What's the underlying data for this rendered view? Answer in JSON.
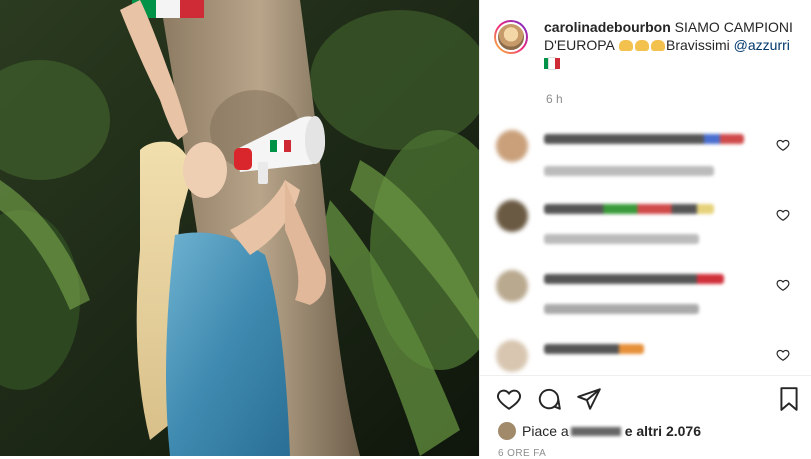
{
  "post": {
    "username": "carolinadebourbon",
    "caption_text": " SIAMO CAMPIONI D'EUROPA ",
    "caption_emoji": [
      "flexed-biceps",
      "flexed-biceps",
      "flexed-biceps"
    ],
    "caption_after": "Bravissimi ",
    "mention": "@azzurri",
    "time_ago": "6 h",
    "likes_prefix": "Piace a",
    "likes_suffix": "e altri 2.076",
    "date_partial": "6 ORE FA"
  },
  "comments": [
    {
      "username": "",
      "text": "",
      "avatar_color": "#c9a07a"
    },
    {
      "username": "",
      "text": "",
      "avatar_color": "#6b5a43"
    },
    {
      "username": "",
      "text": "",
      "avatar_color": "#b9a98e"
    },
    {
      "username": "",
      "text": "",
      "avatar_color": "#d8c6b0"
    }
  ],
  "icons": {
    "like": "heart-icon",
    "comment": "comment-icon",
    "share": "send-icon",
    "save": "bookmark-icon"
  },
  "colors": {
    "text": "#262626",
    "muted": "#8e8e8e",
    "mention": "#00376b",
    "flag_green": "#009246",
    "flag_white": "#ffffff",
    "flag_red": "#ce2b37"
  }
}
